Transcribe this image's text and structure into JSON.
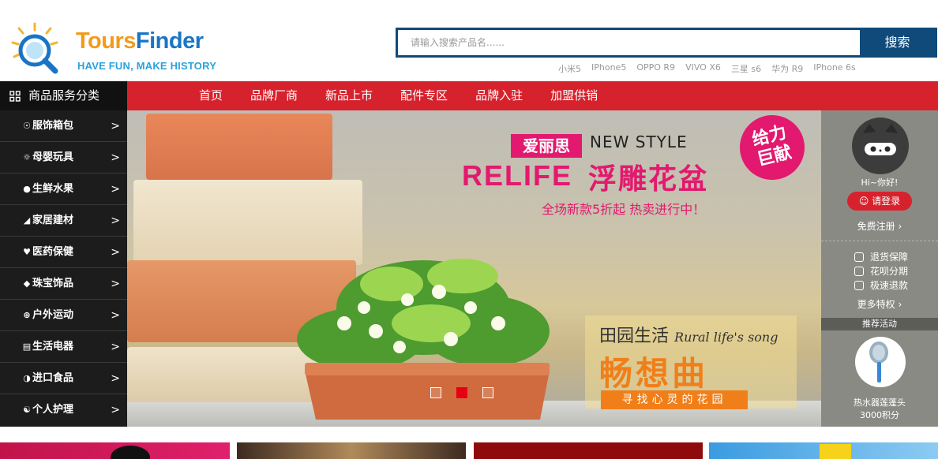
{
  "logo": {
    "brand_part1": "Tours",
    "brand_part2": "Finder",
    "slogan": "HAVE FUN, MAKE HISTORY"
  },
  "search": {
    "placeholder": "请输入搜索产品名......",
    "value": "",
    "button_label": "搜索",
    "hot_keywords": [
      "小米5",
      "IPhone5",
      "OPPO R9",
      "VIVO X6",
      "三星 s6",
      "华为 R9",
      "IPhone 6s"
    ]
  },
  "nav": {
    "category_title": "商品服务分类",
    "links": [
      "首页",
      "品牌厂商",
      "新品上市",
      "配件专区",
      "品牌入驻",
      "加盟供销"
    ]
  },
  "categories": [
    {
      "label": "服饰箱包",
      "icon": "shirt-icon"
    },
    {
      "label": "母婴玩具",
      "icon": "stroller-icon"
    },
    {
      "label": "生鲜水果",
      "icon": "fruit-icon"
    },
    {
      "label": "家居建材",
      "icon": "ruler-icon"
    },
    {
      "label": "医药保健",
      "icon": "heart-icon"
    },
    {
      "label": "珠宝饰品",
      "icon": "diamond-icon"
    },
    {
      "label": "户外运动",
      "icon": "ball-icon"
    },
    {
      "label": "生活电器",
      "icon": "appliance-icon"
    },
    {
      "label": "进口食品",
      "icon": "food-icon"
    },
    {
      "label": "个人护理",
      "icon": "people-icon"
    }
  ],
  "category_arrow": ">",
  "banner": {
    "brand_tag": "爱丽思",
    "new_style": "NEW STYLE",
    "brand_en": "RELIFE",
    "product": "浮雕花盆",
    "gift_line1": "给力",
    "gift_line2": "巨献",
    "subtitle": "全场新款5折起 热卖进行中！",
    "garden_cn": "田园生活",
    "garden_en": "Rural life's song",
    "garden_big": "畅想曲",
    "garden_sub": "寻找心灵的花园",
    "slide_count": 3,
    "active_slide": 2
  },
  "user_panel": {
    "greeting": "Hi~你好!",
    "login_label": "请登录",
    "register_label": "免费注册",
    "perks": [
      "退货保障",
      "花呗分期",
      "极速退款"
    ],
    "more_label": "更多特权",
    "recommend_title": "推荐活动",
    "recommend_item": "热水器莲蓬头",
    "recommend_points": "3000积分"
  },
  "colors": {
    "brand_red": "#d6222d",
    "search_blue": "#0f4a7a",
    "banner_pink": "#e2196e",
    "banner_orange": "#f07f1a",
    "logo_orange": "#f39a1c",
    "logo_blue": "#1a74c6"
  }
}
